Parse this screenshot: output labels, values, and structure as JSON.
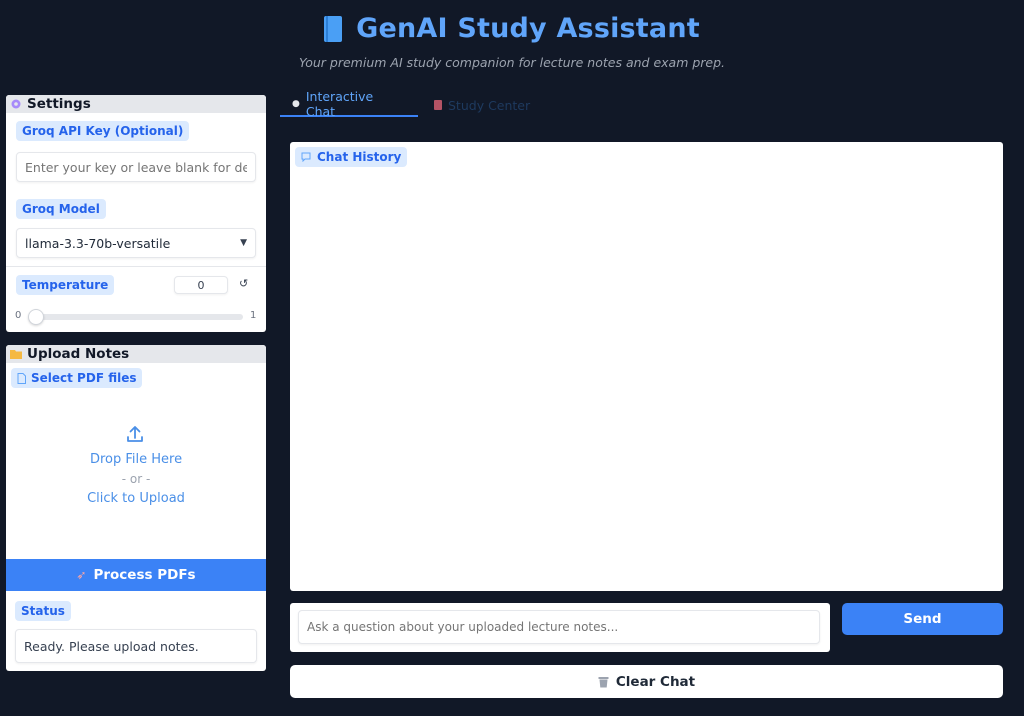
{
  "header": {
    "title": "GenAI Study Assistant",
    "subtitle": "Your premium AI study companion for lecture notes and exam prep."
  },
  "settings": {
    "title": "Settings",
    "api_key_label": "Groq API Key (Optional)",
    "api_key_placeholder": "Enter your key or leave blank for default",
    "model_label": "Groq Model",
    "model_value": "llama-3.3-70b-versatile",
    "temperature_label": "Temperature",
    "temperature_value": "0",
    "slider_min": "0",
    "slider_max": "1",
    "slider_level": 0
  },
  "upload": {
    "title": "Upload Notes",
    "file_label": "Select PDF files",
    "drop_text": "Drop File Here",
    "or_text": "- or -",
    "click_text": "Click to Upload",
    "process_label": "Process PDFs",
    "status_label": "Status",
    "status_value": "Ready. Please upload notes."
  },
  "tabs": [
    {
      "label": "Interactive Chat",
      "active": true
    },
    {
      "label": "Study Center",
      "active": false
    }
  ],
  "chat": {
    "history_label": "Chat History",
    "input_placeholder": "Ask a question about your uploaded lecture notes...",
    "send_label": "Send",
    "clear_label": "Clear Chat"
  },
  "colors": {
    "background": "#111827",
    "accent": "#3b82f6",
    "title": "#60a5fa",
    "chip_bg": "#dbeafe"
  }
}
